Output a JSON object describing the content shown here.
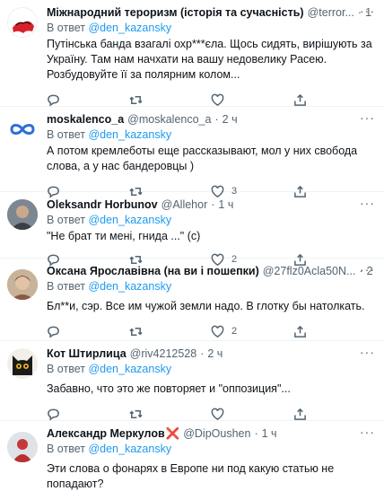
{
  "tweets": [
    {
      "name": "Міжнародний тероризм (історія та сучасність)",
      "handle": "@terror...",
      "time": "1 ч",
      "reply_prefix": "В ответ",
      "reply_to": "@den_kazansky",
      "text": "Путінська банда взагалі охр***єла. Щось сидять, вирішують за Україну. Там нам начхати на вашу недовелику Расею. Розбудовуйте її за полярним колом...",
      "avatar_label": "TERRO RII",
      "counts": {
        "replies": "",
        "retweets": "",
        "likes": ""
      }
    },
    {
      "name": "moskalenco_a",
      "handle": "@moskalenco_a",
      "time": "2 ч",
      "reply_prefix": "В ответ",
      "reply_to": "@den_kazansky",
      "text": "А потом кремлеботы еще рассказывают, мол у них свобода слова, а у нас бандеровцы )",
      "counts": {
        "replies": "",
        "retweets": "",
        "likes": "3"
      }
    },
    {
      "name": "Oleksandr Horbunov",
      "handle": "@Allehor",
      "time": "1 ч",
      "reply_prefix": "В ответ",
      "reply_to": "@den_kazansky",
      "text": "\"Не брат ти мені, гнида ...\" (с)",
      "counts": {
        "replies": "",
        "retweets": "",
        "likes": "2"
      }
    },
    {
      "name": "Оксана Ярославівна (на ви і пошепки)",
      "handle": "@27flz0Acla50N...",
      "time": "2 ч",
      "reply_prefix": "В ответ",
      "reply_to": "@den_kazansky",
      "text": "Бл**и, сэр. Все им чужой земли надо. В глотку бы натолкать.",
      "counts": {
        "replies": "",
        "retweets": "",
        "likes": "2"
      }
    },
    {
      "name": "Кот Штирлица",
      "handle": "@riv4212528",
      "time": "2 ч",
      "reply_prefix": "В ответ",
      "reply_to": "@den_kazansky",
      "text": "Забавно, что это же повторяет и \"оппозиция\"...",
      "counts": {
        "replies": "",
        "retweets": "",
        "likes": ""
      }
    },
    {
      "name": "Александр Меркулов",
      "name_suffix": "❌",
      "handle": "@DipOushen",
      "time": "1 ч",
      "reply_prefix": "В ответ",
      "reply_to": "@den_kazansky",
      "text": "Эти слова о фонарях в Европе ни под какую статью не попадают?",
      "counts": {
        "replies": "",
        "retweets": "",
        "likes": ""
      }
    }
  ],
  "icons": [
    "reply-icon",
    "retweet-icon",
    "like-icon",
    "share-icon",
    "more-icon"
  ],
  "colors": {
    "mention": "#1d9bf0",
    "secondary": "#536471",
    "text": "#0f1419",
    "divider": "#eff3f4"
  }
}
